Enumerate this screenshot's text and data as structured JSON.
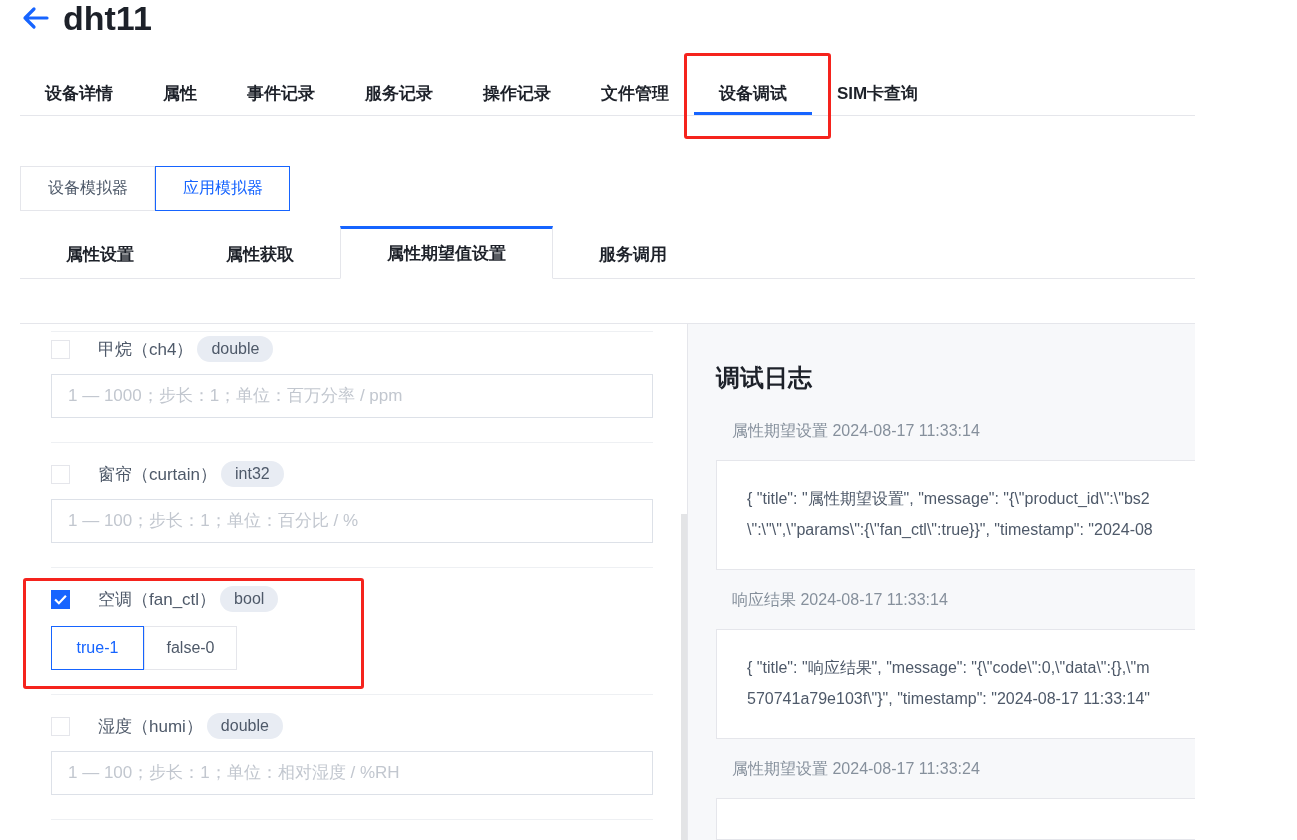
{
  "page": {
    "title": "dht11"
  },
  "tabs": [
    {
      "label": "设备详情",
      "selected": false
    },
    {
      "label": "属性",
      "selected": false
    },
    {
      "label": "事件记录",
      "selected": false
    },
    {
      "label": "服务记录",
      "selected": false
    },
    {
      "label": "操作记录",
      "selected": false
    },
    {
      "label": "文件管理",
      "selected": false
    },
    {
      "label": "设备调试",
      "selected": true
    },
    {
      "label": "SIM卡查询",
      "selected": false
    }
  ],
  "simulators": [
    {
      "label": "设备模拟器",
      "selected": false
    },
    {
      "label": "应用模拟器",
      "selected": true
    }
  ],
  "sub_tabs": [
    {
      "label": "属性设置",
      "selected": false
    },
    {
      "label": "属性获取",
      "selected": false
    },
    {
      "label": "属性期望值设置",
      "selected": true
    },
    {
      "label": "服务调用",
      "selected": false
    }
  ],
  "properties": [
    {
      "kind": "number",
      "checked": false,
      "name": "甲烷",
      "identifier": "（ch4）",
      "type": "double",
      "placeholder": "1 — 1000；步长：1；单位：百万分率 / ppm"
    },
    {
      "kind": "number",
      "checked": false,
      "name": "窗帘",
      "identifier": "（curtain）",
      "type": "int32",
      "placeholder": "1 — 100；步长：1；单位：百分比 / %"
    },
    {
      "kind": "bool",
      "checked": true,
      "name": "空调",
      "identifier": "（fan_ctl）",
      "type": "bool",
      "options": [
        {
          "label": "true-1",
          "selected": true
        },
        {
          "label": "false-0",
          "selected": false
        }
      ]
    },
    {
      "kind": "number",
      "checked": false,
      "name": "湿度",
      "identifier": "（humi）",
      "type": "double",
      "placeholder": "1 — 100；步长：1；单位：相对湿度 / %RH"
    }
  ],
  "log": {
    "title": "调试日志",
    "entries": [
      {
        "header": "属性期望设置 2024-08-17 11:33:14",
        "lines": [
          "{ \"title\": \"属性期望设置\", \"message\": \"{\\\"product_id\\\":\\\"bs2",
          "\\\":\\\"\\\",\\\"params\\\":{\\\"fan_ctl\\\":true}}\", \"timestamp\": \"2024-08"
        ]
      },
      {
        "header": "响应结果 2024-08-17 11:33:14",
        "lines": [
          "{ \"title\": \"响应结果\", \"message\": \"{\\\"code\\\":0,\\\"data\\\":{},\\\"m",
          "570741a79e103f\\\"}\", \"timestamp\": \"2024-08-17 11:33:14\""
        ]
      },
      {
        "header": "属性期望设置 2024-08-17 11:33:24"
      }
    ]
  }
}
